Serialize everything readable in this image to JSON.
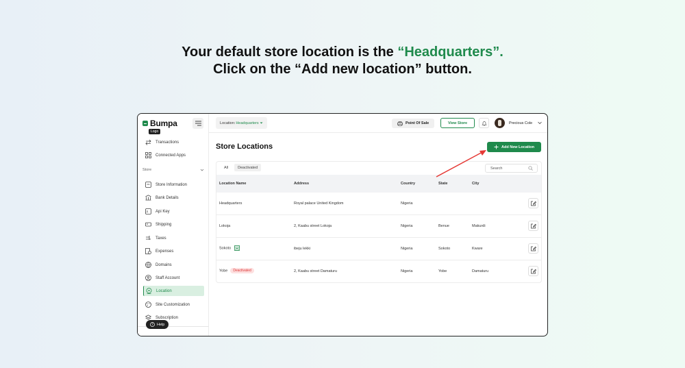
{
  "headline": {
    "line1_prefix": "Your default store location is the ",
    "line1_accent": "“Headquarters”.",
    "line2": "Click on the “Add new location” button."
  },
  "app": {
    "logo_text": "Bumpa",
    "logo_tooltip": "Logo",
    "brand_color": "#1f8a4c"
  },
  "sidebar": {
    "top_items": [
      {
        "label": "Transactions",
        "icon": "transfer-icon"
      },
      {
        "label": "Connected Apps",
        "icon": "apps-grid-icon"
      }
    ],
    "section_label": "Store",
    "items": [
      {
        "label": "Store Information",
        "icon": "store-info-icon"
      },
      {
        "label": "Bank Details",
        "icon": "bank-icon"
      },
      {
        "label": "Api Key",
        "icon": "api-key-icon"
      },
      {
        "label": "Shipping",
        "icon": "truck-icon"
      },
      {
        "label": "Taxes",
        "icon": "tax-icon"
      },
      {
        "label": "Expenses",
        "icon": "expenses-icon"
      },
      {
        "label": "Domains",
        "icon": "globe-icon"
      },
      {
        "label": "Staff Account",
        "icon": "user-circle-icon"
      },
      {
        "label": "Location",
        "icon": "location-pin-icon",
        "active": true
      },
      {
        "label": "Site Customization",
        "icon": "palette-icon"
      },
      {
        "label": "Subscription",
        "icon": "layers-icon"
      }
    ],
    "help_label": "Help"
  },
  "topbar": {
    "location_prefix": "Location: ",
    "location_value": "Headquarters",
    "pos_label": "Point Of Sale",
    "view_store_label": "View Store",
    "user_name": "Precious Cole"
  },
  "main": {
    "title": "Store Locations",
    "add_button_label": "Add New Location",
    "filters": [
      "All",
      "Deactivated"
    ],
    "search_placeholder": "Search",
    "columns": [
      "Location Name",
      "Address",
      "Country",
      "State",
      "City"
    ],
    "rows": [
      {
        "name": "Headquarters",
        "address": "Royal palace United Kingdom",
        "country": "Nigeria",
        "state": "",
        "city": "",
        "badge": ""
      },
      {
        "name": "Lokoja",
        "address": "2, Kaabu street Lokoja",
        "country": "Nigeria",
        "state": "Benue",
        "city": "Makurdi",
        "badge": ""
      },
      {
        "name": "Sokoto",
        "address": "ibeju lekki",
        "country": "Nigeria",
        "state": "Sokoto",
        "city": "Kware",
        "badge": ""
      },
      {
        "name": "Yobe",
        "address": "2, Kaabu street Damaturu",
        "country": "Nigeria",
        "state": "Yobe",
        "city": "Damaturu",
        "badge": "Deactivated"
      }
    ]
  }
}
